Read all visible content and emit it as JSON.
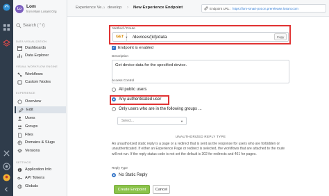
{
  "app": {
    "avatar_initials": "Lo",
    "name": "Lom",
    "org": "from Main Losant Org"
  },
  "search": {
    "placeholder": "Search (⌃/)"
  },
  "sidebar": {
    "sections": [
      {
        "title": "Data Visualization",
        "items": [
          "Dashboards",
          "Data Explorer"
        ]
      },
      {
        "title": "Visual Workflow Engine",
        "items": [
          "Workflows",
          "Custom Nodes"
        ]
      },
      {
        "title": "Experience",
        "items": [
          "Overview",
          "Edit",
          "Users",
          "Groups",
          "Files",
          "Domains & Slugs",
          "Versions"
        ]
      },
      {
        "title": "Settings",
        "items": [
          "Application Info",
          "API Tokens",
          "Globals"
        ]
      }
    ],
    "active_item": "Edit"
  },
  "breadcrumb": {
    "items": [
      "Experience Ve...",
      "develop",
      "New Experience Endpoint"
    ]
  },
  "endpoint_url": {
    "label": "Endpoint URL:",
    "value": "https://lom-smart-pot.on.prerelease.losant.com"
  },
  "form": {
    "route": {
      "label": "Method / Route",
      "method": "GET",
      "path": "/devices/{id}/data",
      "copy_label": "Copy"
    },
    "enabled": {
      "label": "Endpoint is enabled",
      "checked": true
    },
    "description": {
      "label": "Description",
      "value": "Get device data for the specified device."
    },
    "access": {
      "label": "Access Control",
      "options": [
        "All public users",
        "Any authenticated user",
        "Only users who are in the following groups ..."
      ],
      "selected": "Any authenticated user",
      "groups_placeholder": "Select..."
    },
    "unauth": {
      "heading": "UNAUTHORIZED REPLY TYPE",
      "help": "An unauthorized static reply is a page or a redirect that is sent as the response for users who are forbidden or unauthenticated. If either an Experience Page or redirect is selected, the workflows that are attached to the route will not run. If the reply status code is not set the default is 302 for redirects and 401 for pages.",
      "reply_label": "Reply Type",
      "reply_value": "No Static Reply"
    },
    "buttons": {
      "create": "Create Endpoint",
      "cancel": "Cancel"
    }
  },
  "colors": {
    "accent": "#3978c8",
    "highlight": "#e03232",
    "create": "#8bc34a",
    "method": "#d98a00"
  }
}
